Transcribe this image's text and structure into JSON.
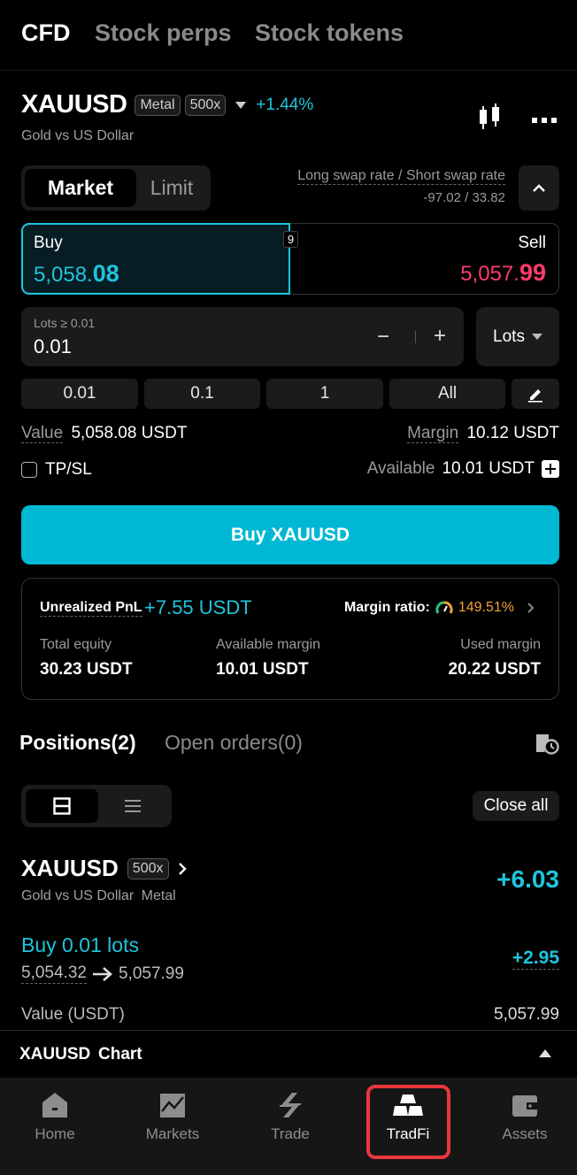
{
  "top_tabs": [
    "CFD",
    "Stock perps",
    "Stock tokens"
  ],
  "instrument": {
    "symbol": "XAUUSD",
    "category_badge": "Metal",
    "leverage_badge": "500x",
    "change": "+1.44%",
    "description": "Gold vs US Dollar"
  },
  "order_type": {
    "market": "Market",
    "limit": "Limit"
  },
  "swap": {
    "label": "Long swap rate / Short swap rate",
    "value": "-97.02 / 33.82"
  },
  "quote": {
    "buy_label": "Buy",
    "buy_price_main": "5,058.",
    "buy_price_tail": "08",
    "spread": "9",
    "sell_label": "Sell",
    "sell_price_main": "5,057.",
    "sell_price_tail": "99"
  },
  "lots_input": {
    "hint": "Lots ≥ 0.01",
    "value": "0.01",
    "minus": "−",
    "plus": "+",
    "unit": "Lots"
  },
  "quick_amounts": [
    "0.01",
    "0.1",
    "1",
    "All"
  ],
  "value_row": {
    "value_label": "Value",
    "value": "5,058.08 USDT",
    "margin_label": "Margin",
    "margin": "10.12 USDT"
  },
  "tpsl": {
    "label": "TP/SL"
  },
  "available": {
    "label": "Available",
    "value": "10.01 USDT"
  },
  "buy_button": "Buy XAUUSD",
  "account": {
    "pnl_label": "Unrealized PnL",
    "pnl_value": "+7.55 USDT",
    "margin_ratio_label": "Margin ratio:",
    "margin_ratio_value": "149.51%",
    "total_equity_label": "Total equity",
    "total_equity": "30.23 USDT",
    "available_margin_label": "Available margin",
    "available_margin": "10.01 USDT",
    "used_margin_label": "Used margin",
    "used_margin": "20.22 USDT"
  },
  "positions_tabs": {
    "positions": "Positions(2)",
    "open_orders": "Open orders(0)"
  },
  "close_all": "Close all",
  "position": {
    "symbol": "XAUUSD",
    "leverage": "500x",
    "description": "Gold vs US Dollar",
    "category": "Metal",
    "pnl": "+6.03",
    "side": "Buy 0.01 lots",
    "entry_price": "5,054.32",
    "mark_price": "5,057.99",
    "leg_pnl": "+2.95",
    "value_label": "Value (USDT)",
    "value": "5,057.99"
  },
  "chart_bar": {
    "symbol": "XAUUSD",
    "label": "Chart"
  },
  "bottom_nav": {
    "home": "Home",
    "markets": "Markets",
    "trade": "Trade",
    "tradfi": "TradFi",
    "assets": "Assets"
  },
  "colors": {
    "accent_teal": "#1fc4dc",
    "sell_pink": "#ff3b6b",
    "highlight_red": "#e8383d",
    "margin_ratio_orange": "#f0a23a"
  }
}
